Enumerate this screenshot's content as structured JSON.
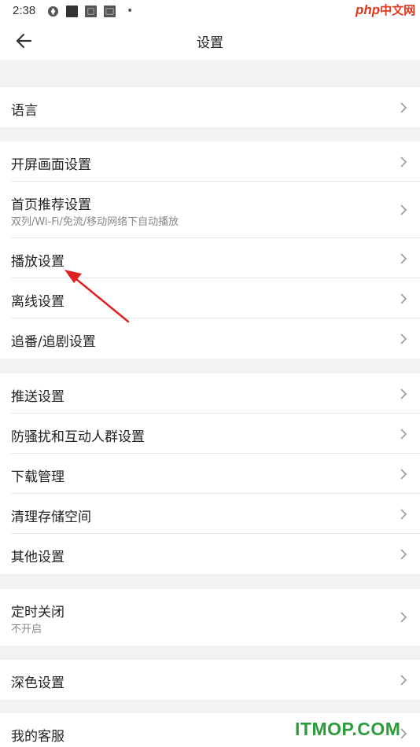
{
  "status_bar": {
    "time": "2:38",
    "icons": [
      "aperture-icon",
      "notification-square-icon",
      "notification-square-icon",
      "notification-square-icon",
      "more-dot-icon"
    ]
  },
  "watermark_top": {
    "php": "php",
    "cn": "中文网"
  },
  "header": {
    "title": "设置",
    "back_icon": "back-arrow-icon"
  },
  "groups": [
    {
      "items": [
        {
          "label": "语言"
        }
      ]
    },
    {
      "items": [
        {
          "label": "开屏画面设置"
        },
        {
          "label": "首页推荐设置",
          "subtitle": "双列/Wi-Fi/免流/移动网络下自动播放"
        },
        {
          "label": "播放设置"
        },
        {
          "label": "离线设置"
        },
        {
          "label": "追番/追剧设置"
        }
      ]
    },
    {
      "items": [
        {
          "label": "推送设置"
        },
        {
          "label": "防骚扰和互动人群设置"
        },
        {
          "label": "下载管理"
        },
        {
          "label": "清理存储空间"
        },
        {
          "label": "其他设置"
        }
      ]
    },
    {
      "items": [
        {
          "label": "定时关闭",
          "subtitle": "不开启"
        }
      ]
    },
    {
      "items": [
        {
          "label": "深色设置"
        }
      ]
    },
    {
      "items": [
        {
          "label": "我的客服"
        }
      ]
    }
  ],
  "annotation": {
    "color": "#e02020",
    "points_to": "播放设置"
  },
  "watermark_bottom": "ITMOP.COM",
  "colors": {
    "background": "#f2f2f4",
    "text": "#222222",
    "subtitle": "#888888",
    "chevron": "#9a9a9a"
  }
}
